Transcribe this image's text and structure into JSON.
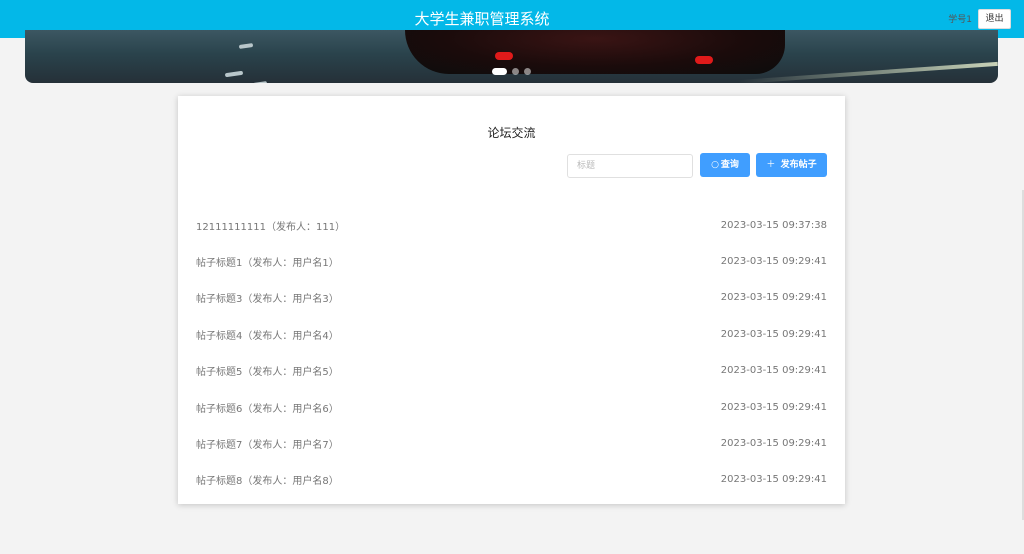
{
  "header": {
    "title": "大学生兼职管理系统",
    "user": "学号1",
    "logout_label": "退出"
  },
  "carousel": {
    "slide_count": 3,
    "active_index": 0
  },
  "forum": {
    "title": "论坛交流",
    "search_placeholder": "标题",
    "query_label": "查询",
    "post_label": "发布帖子",
    "posts": [
      {
        "title": "12111111111（发布人：111）",
        "date": "2023-03-15 09:37:38"
      },
      {
        "title": "帖子标题1（发布人：用户名1）",
        "date": "2023-03-15 09:29:41"
      },
      {
        "title": "帖子标题3（发布人：用户名3）",
        "date": "2023-03-15 09:29:41"
      },
      {
        "title": "帖子标题4（发布人：用户名4）",
        "date": "2023-03-15 09:29:41"
      },
      {
        "title": "帖子标题5（发布人：用户名5）",
        "date": "2023-03-15 09:29:41"
      },
      {
        "title": "帖子标题6（发布人：用户名6）",
        "date": "2023-03-15 09:29:41"
      },
      {
        "title": "帖子标题7（发布人：用户名7）",
        "date": "2023-03-15 09:29:41"
      },
      {
        "title": "帖子标题8（发布人：用户名8）",
        "date": "2023-03-15 09:29:41"
      }
    ]
  }
}
